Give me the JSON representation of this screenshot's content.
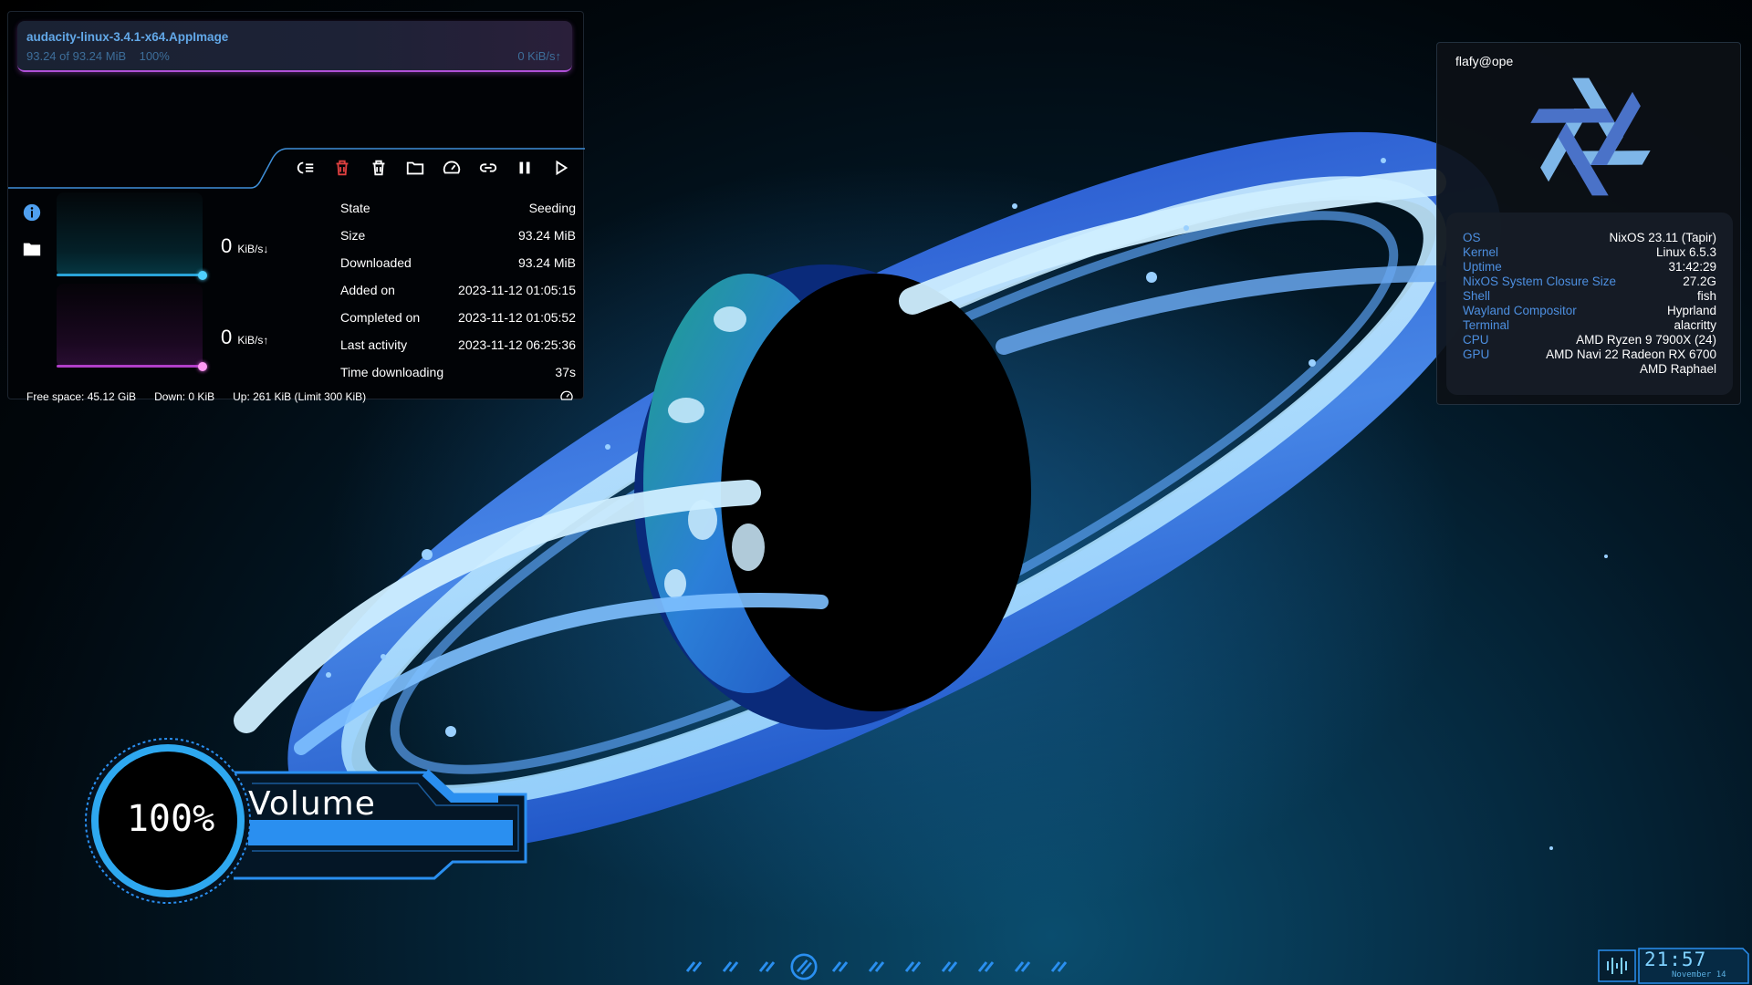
{
  "torrent": {
    "file_name": "audacity-linux-3.4.1-x64.AppImage",
    "progress_text": "93.24 of 93.24 MiB",
    "progress_percent_text": "100%",
    "progress_fraction": 1.0,
    "speed_text": "0 KiB/s",
    "toolbar": {
      "icons": [
        "queue-icon",
        "delete-with-data-icon",
        "delete-icon",
        "folder-icon",
        "speed-limit-icon",
        "link-icon",
        "pause-icon",
        "play-icon"
      ]
    },
    "down_rate": {
      "value": "0",
      "unit": "KiB/s"
    },
    "up_rate": {
      "value": "0",
      "unit": "KiB/s"
    },
    "properties": [
      {
        "key": "State",
        "value": "Seeding"
      },
      {
        "key": "Size",
        "value": "93.24 MiB"
      },
      {
        "key": "Downloaded",
        "value": "93.24 MiB"
      },
      {
        "key": "Added on",
        "value": "2023-11-12 01:05:15"
      },
      {
        "key": "Completed on",
        "value": "2023-11-12 01:05:52"
      },
      {
        "key": "Last activity",
        "value": "2023-11-12 06:25:36"
      },
      {
        "key": "Time downloading",
        "value": "37s"
      }
    ],
    "status": {
      "free_space": "Free space: 45.12 GiB",
      "down": "Down: 0 KiB",
      "up": "Up: 261 KiB (Limit 300 KiB)"
    },
    "colors": {
      "down": "#2aa4d8",
      "up": "#b13ec8",
      "delete": "#e04040"
    }
  },
  "neofetch": {
    "title": "flafy@ope",
    "rows": [
      {
        "key": "OS",
        "value": "NixOS 23.11 (Tapir)"
      },
      {
        "key": "Kernel",
        "value": "Linux 6.5.3"
      },
      {
        "key": "Uptime",
        "value": "31:42:29"
      },
      {
        "key": "NixOS System Closure Size",
        "value": "27.2G"
      },
      {
        "key": "Shell",
        "value": "fish"
      },
      {
        "key": "Wayland Compositor",
        "value": "Hyprland"
      },
      {
        "key": "Terminal",
        "value": "alacritty"
      },
      {
        "key": "CPU",
        "value": "AMD Ryzen 9 7900X (24)"
      },
      {
        "key": "GPU",
        "value": "AMD Navi 22 Radeon RX 6700"
      },
      {
        "key": "",
        "value": "AMD Raphael"
      }
    ],
    "colors": {
      "key": "#4d8fe0",
      "logo_dark": "#4a72c8",
      "logo_light": "#7eb6e8"
    }
  },
  "volume": {
    "percent_text": "100%",
    "label": "Volume",
    "level_fraction": 1.0,
    "color": "#2a8ff0"
  },
  "workspaces": {
    "count": 11,
    "active_index": 3
  },
  "clock": {
    "time": "21:57",
    "date": "November 14"
  }
}
